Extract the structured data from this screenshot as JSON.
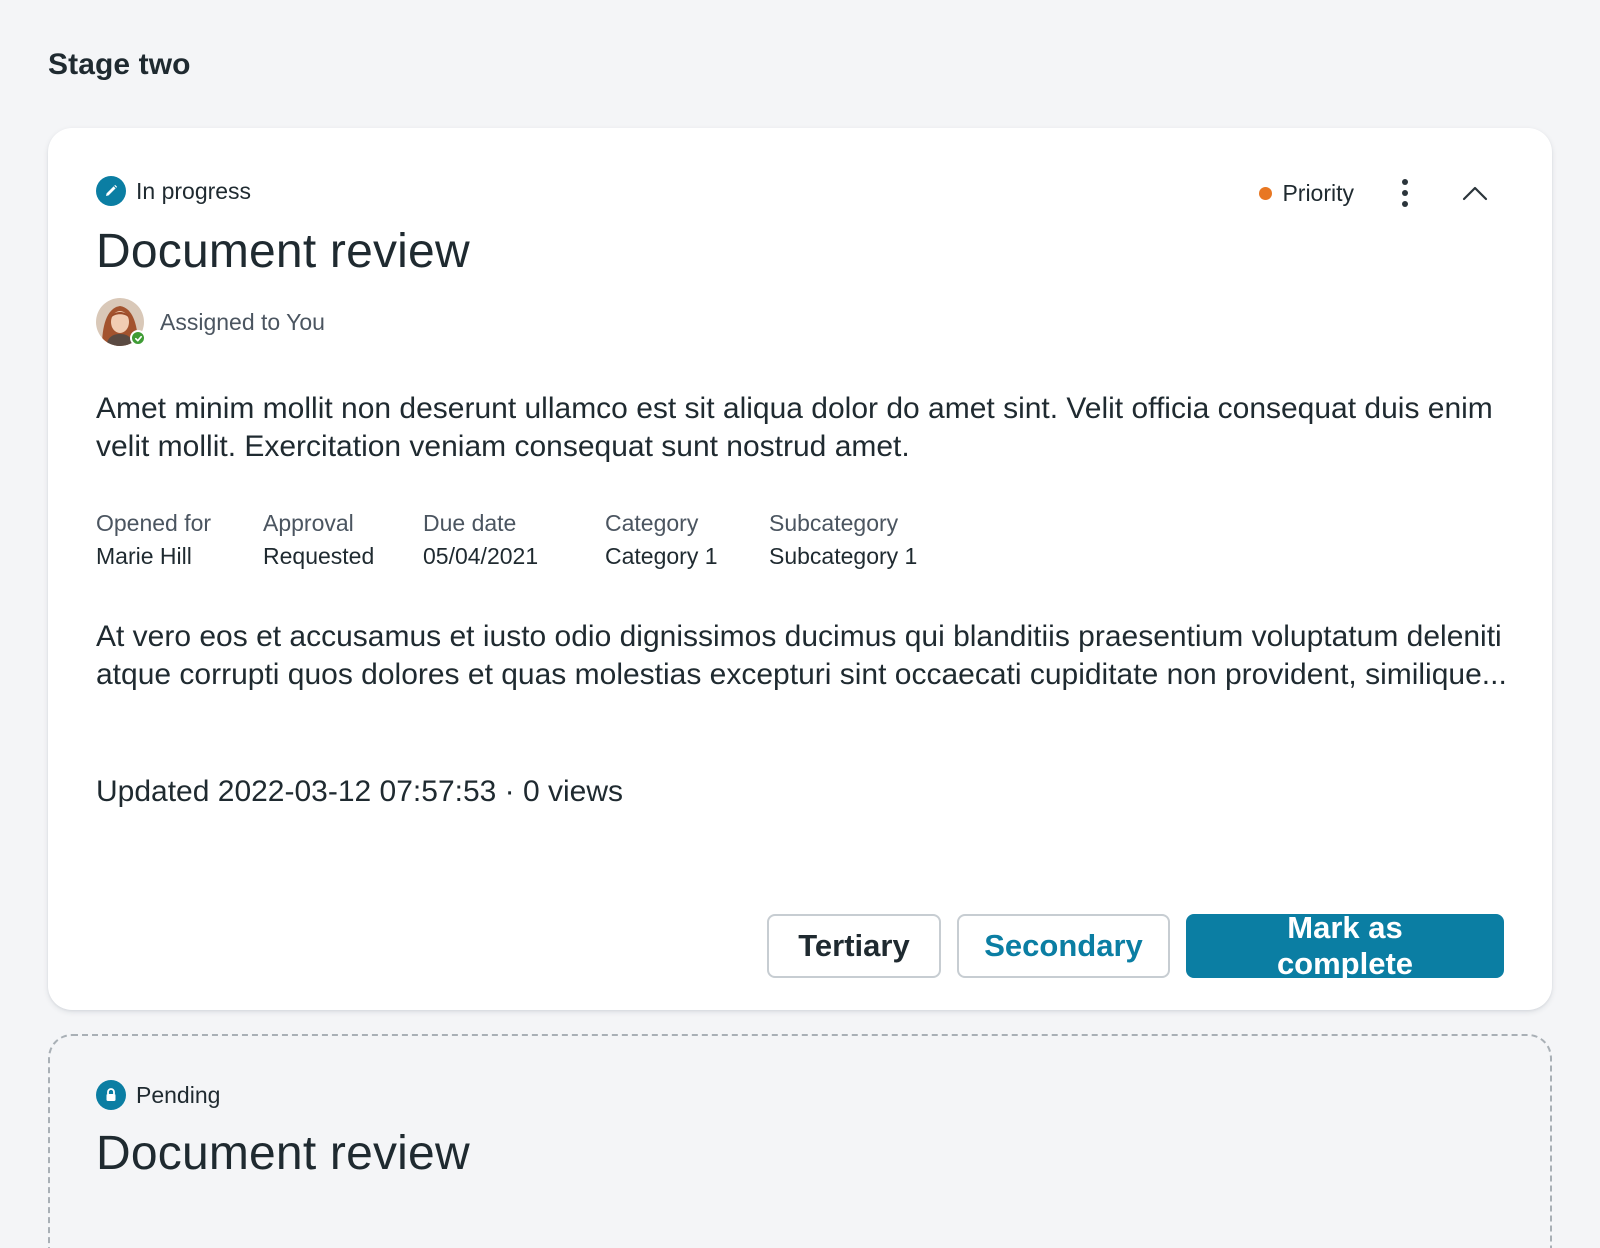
{
  "stage": {
    "title": "Stage two"
  },
  "active_card": {
    "status": {
      "label": "In progress",
      "icon": "pencil-icon"
    },
    "priority": {
      "label": "Priority",
      "color": "#e87722"
    },
    "title": "Document review",
    "assignee": {
      "label": "Assigned to You",
      "presence_color": "#3f9c35"
    },
    "description": "Amet minim mollit non deserunt ullamco est sit aliqua dolor do amet sint. Velit officia consequat duis enim velit mollit. Exercitation veniam consequat sunt nostrud amet.",
    "meta": [
      {
        "label": "Opened for",
        "value": "Marie Hill"
      },
      {
        "label": "Approval",
        "value": "Requested"
      },
      {
        "label": "Due date",
        "value": "05/04/2021"
      },
      {
        "label": "Category",
        "value": "Category 1"
      },
      {
        "label": "Subcategory",
        "value": "Subcategory 1"
      }
    ],
    "summary": "At vero eos et accusamus et iusto odio dignissimos ducimus qui blanditiis praesentium voluptatum deleniti atque corrupti quos dolores et quas molestias excepturi sint occaecati cupiditate non provident, similique...",
    "updated": "Updated 2022-03-12 07:57:53 · 0 views",
    "actions": {
      "tertiary": "Tertiary",
      "secondary": "Secondary",
      "primary": "Mark as complete"
    }
  },
  "pending_card": {
    "status": {
      "label": "Pending",
      "icon": "lock-icon"
    },
    "title": "Document review"
  },
  "colors": {
    "accent": "#0b7ea3",
    "priority": "#e87722",
    "presence": "#3f9c35"
  }
}
